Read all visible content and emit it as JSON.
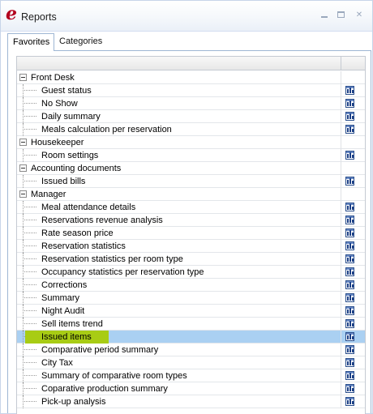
{
  "window": {
    "title": "Reports",
    "logo_letter": "e",
    "accent_color": "#b3001e"
  },
  "tabs": [
    {
      "label": "Favorites",
      "active": true
    },
    {
      "label": "Categories",
      "active": false
    }
  ],
  "rows": [
    {
      "type": "group",
      "label": "Front Desk"
    },
    {
      "type": "item",
      "label": "Guest status",
      "icon": "report-icon"
    },
    {
      "type": "item",
      "label": "No Show",
      "icon": "report-icon"
    },
    {
      "type": "item",
      "label": "Daily summary",
      "icon": "report-icon"
    },
    {
      "type": "item",
      "label": "Meals calculation per reservation",
      "icon": "report-icon"
    },
    {
      "type": "group",
      "label": "Housekeeper"
    },
    {
      "type": "item",
      "label": "Room settings",
      "icon": "report-icon"
    },
    {
      "type": "group",
      "label": "Accounting documents"
    },
    {
      "type": "item",
      "label": "Issued bills",
      "icon": "report-icon"
    },
    {
      "type": "group",
      "label": "Manager"
    },
    {
      "type": "item",
      "label": "Meal attendance details",
      "icon": "report-icon"
    },
    {
      "type": "item",
      "label": "Reservations revenue analysis",
      "icon": "report-icon"
    },
    {
      "type": "item",
      "label": "Rate season price",
      "icon": "report-icon"
    },
    {
      "type": "item",
      "label": "Reservation statistics",
      "icon": "report-icon"
    },
    {
      "type": "item",
      "label": "Reservation statistics per room type",
      "icon": "report-icon"
    },
    {
      "type": "item",
      "label": "Occupancy statistics  per  reservation type",
      "icon": "report-icon"
    },
    {
      "type": "item",
      "label": "Corrections",
      "icon": "report-icon"
    },
    {
      "type": "item",
      "label": "Summary",
      "icon": "report-icon"
    },
    {
      "type": "item",
      "label": "Night Audit",
      "icon": "report-icon"
    },
    {
      "type": "item",
      "label": "Sell items trend",
      "icon": "report-icon"
    },
    {
      "type": "item",
      "label": "Issued items",
      "icon": "report-icon",
      "selected": true
    },
    {
      "type": "item",
      "label": "Comparative period summary",
      "icon": "report-icon"
    },
    {
      "type": "item",
      "label": "City Tax",
      "icon": "report-icon"
    },
    {
      "type": "item",
      "label": "Summary of comparative room types",
      "icon": "report-icon"
    },
    {
      "type": "item",
      "label": "Coparative production summary",
      "icon": "report-icon"
    },
    {
      "type": "item",
      "label": "Pick-up analysis",
      "icon": "report-icon"
    }
  ],
  "colors": {
    "selected_row": "#aad0f2",
    "selected_highlight": "#a8cc14",
    "border": "#9eb6d4"
  }
}
